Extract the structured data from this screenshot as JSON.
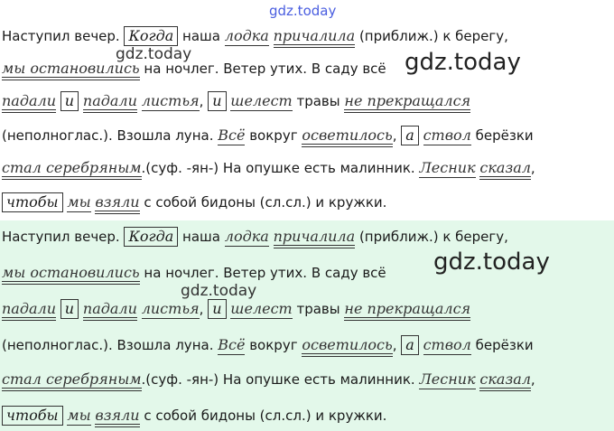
{
  "watermarks": {
    "top": "gdz.today",
    "small_1": "gdz.today",
    "large_1": "gdz.today",
    "large_2": "gdz.today",
    "small_2": "gdz.today"
  },
  "text": {
    "l1_a": "Наступил вечер.",
    "l1_kogda": "Когда",
    "l1_b": "наша",
    "l1_lodka": "лодка",
    "l1_prichalila": "причалила",
    "l1_c": "(приближ.) к берегу,",
    "l2_my": "мы остановились",
    "l2_b": "на ночлег. Ветер утих. В саду всё",
    "l3_padali1": "падали",
    "l3_i1": "и",
    "l3_padali2": "падали",
    "l3_listya": "листья",
    "l3_comma": ",",
    "l3_i2": "и",
    "l3_shelest": "шелест",
    "l3_b": "травы",
    "l3_ne": "не прекращался",
    "l4_a": "(неполноглас.). Взошла луна.",
    "l4_vsyo": "Всё",
    "l4_b": "вокруг",
    "l4_osvet": "осветилось",
    "l4_comma": ",",
    "l4_a2": "а",
    "l4_stvol": "ствол",
    "l4_c": "берёзки",
    "l5_stal": "стал серебряным",
    "l5_b": ".(суф. -ян-) На опушке есть малинник.",
    "l5_lesnik": "Лесник",
    "l5_skazal": "сказал",
    "l5_comma": ",",
    "l6_chtoby": "чтобы",
    "l6_my": "мы",
    "l6_vzyali": "взяли",
    "l6_b": "с собой бидоны (сл.сл.) и кружки."
  }
}
